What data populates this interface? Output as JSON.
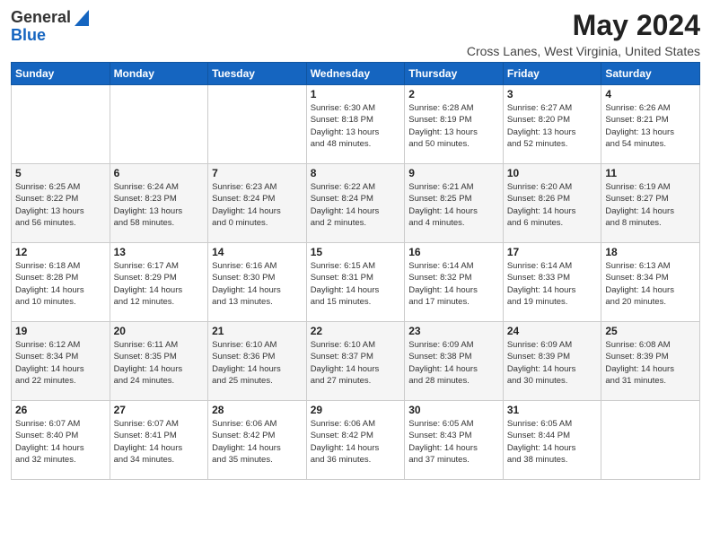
{
  "header": {
    "logo_line1": "General",
    "logo_line2": "Blue",
    "month": "May 2024",
    "location": "Cross Lanes, West Virginia, United States"
  },
  "days_of_week": [
    "Sunday",
    "Monday",
    "Tuesday",
    "Wednesday",
    "Thursday",
    "Friday",
    "Saturday"
  ],
  "weeks": [
    [
      {
        "day": "",
        "info": ""
      },
      {
        "day": "",
        "info": ""
      },
      {
        "day": "",
        "info": ""
      },
      {
        "day": "1",
        "info": "Sunrise: 6:30 AM\nSunset: 8:18 PM\nDaylight: 13 hours\nand 48 minutes."
      },
      {
        "day": "2",
        "info": "Sunrise: 6:28 AM\nSunset: 8:19 PM\nDaylight: 13 hours\nand 50 minutes."
      },
      {
        "day": "3",
        "info": "Sunrise: 6:27 AM\nSunset: 8:20 PM\nDaylight: 13 hours\nand 52 minutes."
      },
      {
        "day": "4",
        "info": "Sunrise: 6:26 AM\nSunset: 8:21 PM\nDaylight: 13 hours\nand 54 minutes."
      }
    ],
    [
      {
        "day": "5",
        "info": "Sunrise: 6:25 AM\nSunset: 8:22 PM\nDaylight: 13 hours\nand 56 minutes."
      },
      {
        "day": "6",
        "info": "Sunrise: 6:24 AM\nSunset: 8:23 PM\nDaylight: 13 hours\nand 58 minutes."
      },
      {
        "day": "7",
        "info": "Sunrise: 6:23 AM\nSunset: 8:24 PM\nDaylight: 14 hours\nand 0 minutes."
      },
      {
        "day": "8",
        "info": "Sunrise: 6:22 AM\nSunset: 8:24 PM\nDaylight: 14 hours\nand 2 minutes."
      },
      {
        "day": "9",
        "info": "Sunrise: 6:21 AM\nSunset: 8:25 PM\nDaylight: 14 hours\nand 4 minutes."
      },
      {
        "day": "10",
        "info": "Sunrise: 6:20 AM\nSunset: 8:26 PM\nDaylight: 14 hours\nand 6 minutes."
      },
      {
        "day": "11",
        "info": "Sunrise: 6:19 AM\nSunset: 8:27 PM\nDaylight: 14 hours\nand 8 minutes."
      }
    ],
    [
      {
        "day": "12",
        "info": "Sunrise: 6:18 AM\nSunset: 8:28 PM\nDaylight: 14 hours\nand 10 minutes."
      },
      {
        "day": "13",
        "info": "Sunrise: 6:17 AM\nSunset: 8:29 PM\nDaylight: 14 hours\nand 12 minutes."
      },
      {
        "day": "14",
        "info": "Sunrise: 6:16 AM\nSunset: 8:30 PM\nDaylight: 14 hours\nand 13 minutes."
      },
      {
        "day": "15",
        "info": "Sunrise: 6:15 AM\nSunset: 8:31 PM\nDaylight: 14 hours\nand 15 minutes."
      },
      {
        "day": "16",
        "info": "Sunrise: 6:14 AM\nSunset: 8:32 PM\nDaylight: 14 hours\nand 17 minutes."
      },
      {
        "day": "17",
        "info": "Sunrise: 6:14 AM\nSunset: 8:33 PM\nDaylight: 14 hours\nand 19 minutes."
      },
      {
        "day": "18",
        "info": "Sunrise: 6:13 AM\nSunset: 8:34 PM\nDaylight: 14 hours\nand 20 minutes."
      }
    ],
    [
      {
        "day": "19",
        "info": "Sunrise: 6:12 AM\nSunset: 8:34 PM\nDaylight: 14 hours\nand 22 minutes."
      },
      {
        "day": "20",
        "info": "Sunrise: 6:11 AM\nSunset: 8:35 PM\nDaylight: 14 hours\nand 24 minutes."
      },
      {
        "day": "21",
        "info": "Sunrise: 6:10 AM\nSunset: 8:36 PM\nDaylight: 14 hours\nand 25 minutes."
      },
      {
        "day": "22",
        "info": "Sunrise: 6:10 AM\nSunset: 8:37 PM\nDaylight: 14 hours\nand 27 minutes."
      },
      {
        "day": "23",
        "info": "Sunrise: 6:09 AM\nSunset: 8:38 PM\nDaylight: 14 hours\nand 28 minutes."
      },
      {
        "day": "24",
        "info": "Sunrise: 6:09 AM\nSunset: 8:39 PM\nDaylight: 14 hours\nand 30 minutes."
      },
      {
        "day": "25",
        "info": "Sunrise: 6:08 AM\nSunset: 8:39 PM\nDaylight: 14 hours\nand 31 minutes."
      }
    ],
    [
      {
        "day": "26",
        "info": "Sunrise: 6:07 AM\nSunset: 8:40 PM\nDaylight: 14 hours\nand 32 minutes."
      },
      {
        "day": "27",
        "info": "Sunrise: 6:07 AM\nSunset: 8:41 PM\nDaylight: 14 hours\nand 34 minutes."
      },
      {
        "day": "28",
        "info": "Sunrise: 6:06 AM\nSunset: 8:42 PM\nDaylight: 14 hours\nand 35 minutes."
      },
      {
        "day": "29",
        "info": "Sunrise: 6:06 AM\nSunset: 8:42 PM\nDaylight: 14 hours\nand 36 minutes."
      },
      {
        "day": "30",
        "info": "Sunrise: 6:05 AM\nSunset: 8:43 PM\nDaylight: 14 hours\nand 37 minutes."
      },
      {
        "day": "31",
        "info": "Sunrise: 6:05 AM\nSunset: 8:44 PM\nDaylight: 14 hours\nand 38 minutes."
      },
      {
        "day": "",
        "info": ""
      }
    ]
  ]
}
